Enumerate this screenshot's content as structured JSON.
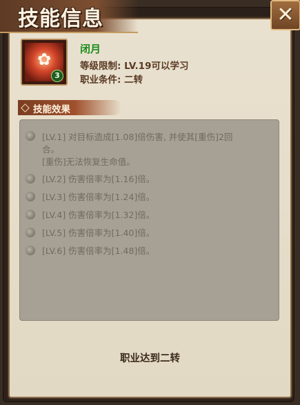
{
  "window": {
    "title": "技能信息",
    "close_icon": "close-icon"
  },
  "skill": {
    "name": "闭月",
    "level_badge": "3",
    "level_requirement": "等级限制: LV.19可以学习",
    "job_requirement": "职业条件: 二转"
  },
  "section": {
    "title": "技能效果"
  },
  "effects": [
    {
      "line1": "[LV.1] 对目标造成[1.08]倍伤害, 并使其[重伤]2回",
      "line2": "合。",
      "line3": "[重伤]无法恢复生命值。"
    },
    {
      "line1": "[LV.2] 伤害倍率为[1.16]倍。"
    },
    {
      "line1": "[LV.3] 伤害倍率为[1.24]倍。"
    },
    {
      "line1": "[LV.4] 伤害倍率为[1.32]倍。"
    },
    {
      "line1": "[LV.5] 伤害倍率为[1.40]倍。"
    },
    {
      "line1": "[LV.6] 伤害倍率为[1.48]倍。"
    }
  ],
  "footer": {
    "text": "职业达到二转"
  },
  "colors": {
    "skill_name": "#1c8c1c",
    "panel": "#e6ddc9",
    "effects_bg": "#a7a094"
  }
}
